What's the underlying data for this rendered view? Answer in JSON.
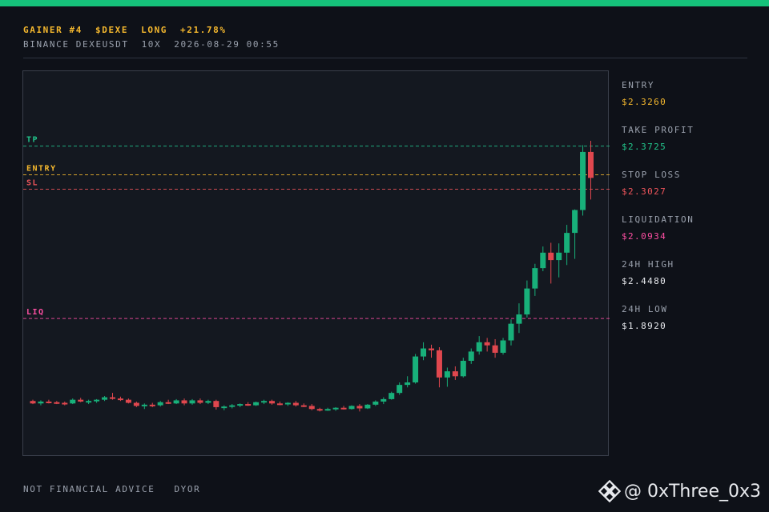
{
  "header": {
    "line1": [
      "GAINER #4",
      "$DEXE",
      "LONG",
      "+21.78%"
    ],
    "line2": [
      "BINANCE DEXEUSDT",
      "10X",
      "2026-08-29 00:55"
    ]
  },
  "stats": [
    {
      "label": "ENTRY",
      "value": "$2.3260",
      "color": "#f5b82e"
    },
    {
      "label": "TAKE PROFIT",
      "value": "$2.3725",
      "color": "#22c58b"
    },
    {
      "label": "STOP LOSS",
      "value": "$2.3027",
      "color": "#f0555b"
    },
    {
      "label": "LIQUIDATION",
      "value": "$2.0934",
      "color": "#ff4fa3"
    },
    {
      "label": "24H HIGH",
      "value": "$2.4480",
      "color": "#e8eaee"
    },
    {
      "label": "24H LOW",
      "value": "$1.8920",
      "color": "#e8eaee"
    }
  ],
  "footer": [
    "NOT FINANCIAL ADVICE",
    "DYOR"
  ],
  "watermark": {
    "handle": "@ 0xThree_0x3",
    "icon": "binance-logo-icon"
  },
  "colors": {
    "up": "#18b07a",
    "down": "#e0474e",
    "accent": "#15c27a"
  },
  "chart_data": {
    "type": "candlestick",
    "ylim": [
      1.88,
      2.46
    ],
    "levels": [
      {
        "label": "TP",
        "value": 2.3725,
        "color": "#22c58b"
      },
      {
        "label": "ENTRY",
        "value": 2.326,
        "color": "#f5b82e"
      },
      {
        "label": "SL",
        "value": 2.3027,
        "color": "#f0555b"
      },
      {
        "label": "LIQ",
        "value": 2.0934,
        "color": "#ff4fa3"
      }
    ],
    "candles": [
      [
        1.96,
        1.962,
        1.955,
        1.956
      ],
      [
        1.956,
        1.961,
        1.953,
        1.959
      ],
      [
        1.959,
        1.962,
        1.956,
        1.958
      ],
      [
        1.958,
        1.96,
        1.955,
        1.957
      ],
      [
        1.957,
        1.959,
        1.953,
        1.956
      ],
      [
        1.956,
        1.964,
        1.955,
        1.962
      ],
      [
        1.962,
        1.965,
        1.958,
        1.959
      ],
      [
        1.959,
        1.962,
        1.955,
        1.96
      ],
      [
        1.96,
        1.963,
        1.957,
        1.962
      ],
      [
        1.962,
        1.968,
        1.96,
        1.966
      ],
      [
        1.966,
        1.973,
        1.962,
        1.964
      ],
      [
        1.964,
        1.967,
        1.96,
        1.962
      ],
      [
        1.962,
        1.964,
        1.956,
        1.957
      ],
      [
        1.957,
        1.959,
        1.95,
        1.952
      ],
      [
        1.952,
        1.956,
        1.947,
        1.954
      ],
      [
        1.954,
        1.957,
        1.95,
        1.953
      ],
      [
        1.953,
        1.96,
        1.951,
        1.958
      ],
      [
        1.958,
        1.962,
        1.955,
        1.956
      ],
      [
        1.956,
        1.963,
        1.955,
        1.961
      ],
      [
        1.961,
        1.964,
        1.953,
        1.956
      ],
      [
        1.956,
        1.963,
        1.954,
        1.961
      ],
      [
        1.961,
        1.964,
        1.955,
        1.957
      ],
      [
        1.957,
        1.962,
        1.955,
        1.96
      ],
      [
        1.96,
        1.962,
        1.946,
        1.95
      ],
      [
        1.95,
        1.953,
        1.945,
        1.951
      ],
      [
        1.951,
        1.955,
        1.948,
        1.953
      ],
      [
        1.953,
        1.956,
        1.95,
        1.955
      ],
      [
        1.955,
        1.958,
        1.952,
        1.953
      ],
      [
        1.953,
        1.959,
        1.952,
        1.958
      ],
      [
        1.958,
        1.962,
        1.955,
        1.96
      ],
      [
        1.96,
        1.962,
        1.954,
        1.956
      ],
      [
        1.956,
        1.959,
        1.953,
        1.955
      ],
      [
        1.955,
        1.958,
        1.952,
        1.957
      ],
      [
        1.957,
        1.96,
        1.951,
        1.953
      ],
      [
        1.953,
        1.956,
        1.95,
        1.952
      ],
      [
        1.952,
        1.955,
        1.945,
        1.947
      ],
      [
        1.947,
        1.949,
        1.943,
        1.946
      ],
      [
        1.946,
        1.949,
        1.944,
        1.947
      ],
      [
        1.947,
        1.95,
        1.944,
        1.949
      ],
      [
        1.949,
        1.952,
        1.946,
        1.947
      ],
      [
        1.947,
        1.953,
        1.946,
        1.952
      ],
      [
        1.952,
        1.955,
        1.943,
        1.948
      ],
      [
        1.948,
        1.955,
        1.947,
        1.954
      ],
      [
        1.954,
        1.961,
        1.952,
        1.959
      ],
      [
        1.959,
        1.966,
        1.955,
        1.963
      ],
      [
        1.963,
        1.975,
        1.962,
        1.973
      ],
      [
        1.973,
        1.99,
        1.97,
        1.986
      ],
      [
        1.986,
        2.0,
        1.982,
        1.99
      ],
      [
        1.99,
        2.036,
        1.988,
        2.032
      ],
      [
        2.032,
        2.055,
        2.026,
        2.045
      ],
      [
        2.045,
        2.051,
        2.03,
        2.042
      ],
      [
        2.042,
        2.047,
        1.982,
        1.998
      ],
      [
        1.998,
        2.014,
        1.983,
        2.008
      ],
      [
        2.008,
        2.016,
        1.994,
        2.0
      ],
      [
        2.0,
        2.03,
        1.998,
        2.025
      ],
      [
        2.025,
        2.045,
        2.02,
        2.04
      ],
      [
        2.04,
        2.065,
        2.035,
        2.055
      ],
      [
        2.055,
        2.062,
        2.04,
        2.05
      ],
      [
        2.05,
        2.06,
        2.03,
        2.038
      ],
      [
        2.038,
        2.062,
        2.035,
        2.058
      ],
      [
        2.058,
        2.092,
        2.05,
        2.085
      ],
      [
        2.085,
        2.118,
        2.07,
        2.1
      ],
      [
        2.1,
        2.155,
        2.095,
        2.142
      ],
      [
        2.142,
        2.182,
        2.13,
        2.175
      ],
      [
        2.175,
        2.21,
        2.17,
        2.2
      ],
      [
        2.2,
        2.216,
        2.15,
        2.188
      ],
      [
        2.188,
        2.215,
        2.16,
        2.2
      ],
      [
        2.2,
        2.245,
        2.18,
        2.232
      ],
      [
        2.232,
        2.27,
        2.19,
        2.269
      ],
      [
        2.269,
        2.374,
        2.26,
        2.363
      ],
      [
        2.363,
        2.381,
        2.286,
        2.321
      ]
    ]
  }
}
